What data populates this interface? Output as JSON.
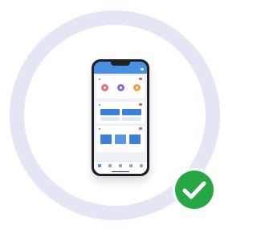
{
  "colors": {
    "ring": "#e4e6f6",
    "phone_frame": "#1f1f24",
    "app_header": "#4a90e2",
    "accent_blue": "#3d7fd9",
    "check_green": "#27a744",
    "circle_pink": "#e86c7a",
    "circle_purple": "#8a6ad9",
    "circle_orange": "#f2a13c"
  },
  "icons": {
    "badge": "check-circle-icon",
    "tabs": [
      "home-icon",
      "list-icon",
      "chart-icon",
      "doc-icon",
      "user-icon"
    ]
  },
  "phone": {
    "header": {
      "title": ""
    },
    "sections": [
      {
        "title": "",
        "buttons": [
          {
            "label": "",
            "color": "#e86c7a"
          },
          {
            "label": "",
            "color": "#8a6ad9"
          },
          {
            "label": "",
            "color": "#f2a13c"
          }
        ]
      },
      {
        "title": "",
        "tiles": [
          {
            "label": ""
          },
          {
            "label": ""
          }
        ]
      },
      {
        "title": "",
        "tiles": [
          {
            "label": ""
          },
          {
            "label": ""
          },
          {
            "label": ""
          }
        ]
      }
    ],
    "tabbar": [
      {
        "label": ""
      },
      {
        "label": ""
      },
      {
        "label": ""
      },
      {
        "label": ""
      },
      {
        "label": ""
      }
    ]
  }
}
